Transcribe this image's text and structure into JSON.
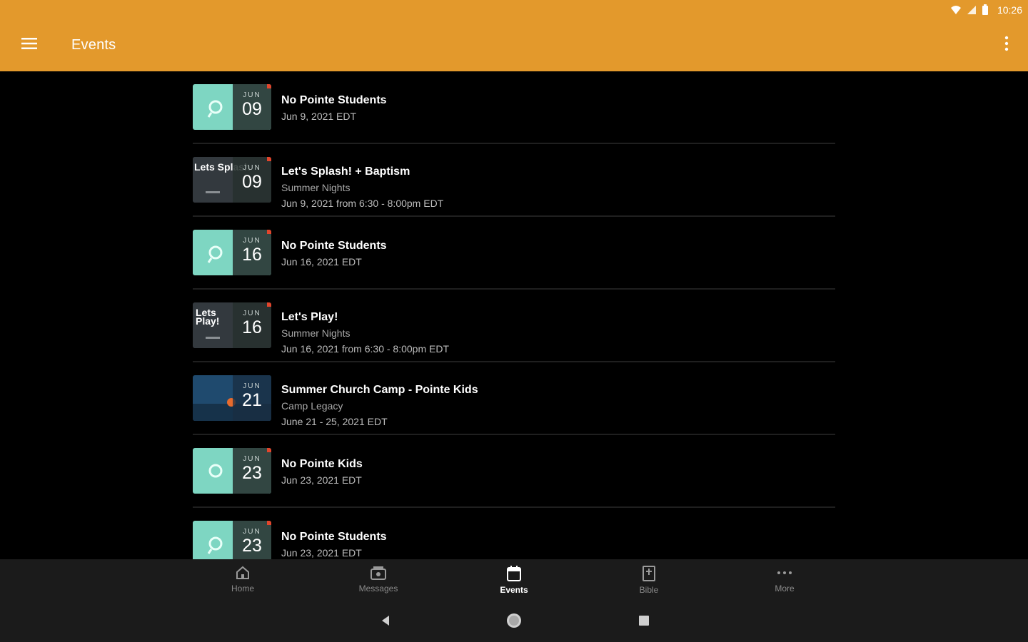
{
  "status_bar": {
    "time": "10:26"
  },
  "app_bar": {
    "title": "Events",
    "accent_color": "#e3992c"
  },
  "events": [
    {
      "title": "No Pointe Students",
      "subtitle": "",
      "date": "Jun 9, 2021 EDT",
      "month": "JUN",
      "day": "09",
      "thumb": "mint"
    },
    {
      "title": "Let's Splash! + Baptism",
      "subtitle": "Summer Nights",
      "date": "Jun 9, 2021 from 6:30 - 8:00pm EDT",
      "month": "JUN",
      "day": "09",
      "thumb": "dark",
      "thumb_text": "Lets Splash"
    },
    {
      "title": "No Pointe Students",
      "subtitle": "",
      "date": "Jun 16, 2021 EDT",
      "month": "JUN",
      "day": "16",
      "thumb": "mint"
    },
    {
      "title": "Let's Play!",
      "subtitle": "Summer Nights",
      "date": "Jun 16, 2021 from 6:30 - 8:00pm EDT",
      "month": "JUN",
      "day": "16",
      "thumb": "dark",
      "thumb_text": "Lets Play!"
    },
    {
      "title": "Summer Church Camp - Pointe Kids",
      "subtitle": "Camp Legacy",
      "date": "June 21 - 25, 2021 EDT",
      "month": "JUN",
      "day": "21",
      "thumb": "camp"
    },
    {
      "title": "No Pointe Kids",
      "subtitle": "",
      "date": "Jun 23, 2021 EDT",
      "month": "JUN",
      "day": "23",
      "thumb": "mint"
    },
    {
      "title": "No Pointe Students",
      "subtitle": "",
      "date": "Jun 23, 2021 EDT",
      "month": "JUN",
      "day": "23",
      "thumb": "mint"
    }
  ],
  "bottom_nav": [
    {
      "label": "Home",
      "icon": "home-icon",
      "active": false
    },
    {
      "label": "Messages",
      "icon": "messages-icon",
      "active": false
    },
    {
      "label": "Events",
      "icon": "calendar-icon",
      "active": true
    },
    {
      "label": "Bible",
      "icon": "bible-icon",
      "active": false
    },
    {
      "label": "More",
      "icon": "more-horizontal-icon",
      "active": false
    }
  ],
  "system_nav": {
    "back": "back-icon",
    "home": "home-circle-icon",
    "recents": "recents-icon"
  }
}
